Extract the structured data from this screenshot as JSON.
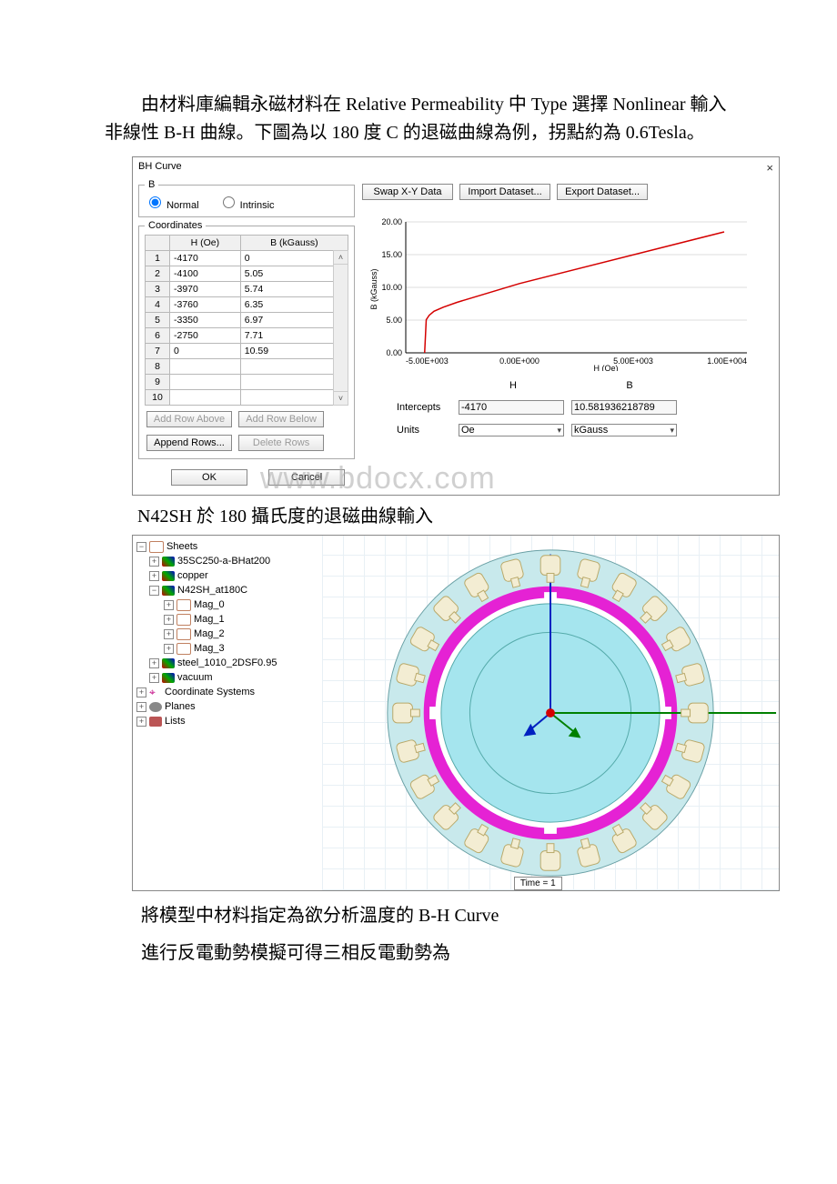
{
  "paragraphs": {
    "p1": "由材料庫編輯永磁材料在 Relative Permeability 中 Type 選擇 Nonlinear 輸入非線性 B-H 曲線。下圖為以 180 度 C 的退磁曲線為例，拐點約為 0.6Tesla。",
    "caption1": "N42SH 於 180 攝氏度的退磁曲線輸入",
    "p2": "將模型中材料指定為欲分析溫度的 B-H Curve",
    "p3": "進行反電動勢模擬可得三相反電動勢為"
  },
  "watermark": "www.bdocx.com",
  "dialog": {
    "title": "BH Curve",
    "close": "×",
    "group_b": "B",
    "radio_normal": "Normal",
    "radio_intrinsic": "Intrinsic",
    "btn_swap": "Swap X-Y Data",
    "btn_import": "Import Dataset...",
    "btn_export": "Export Dataset...",
    "group_coord": "Coordinates",
    "col_h": "H (Oe)",
    "col_b": "B (kGauss)",
    "rows": [
      {
        "n": "1",
        "h": "-4170",
        "b": "0"
      },
      {
        "n": "2",
        "h": "-4100",
        "b": "5.05"
      },
      {
        "n": "3",
        "h": "-3970",
        "b": "5.74"
      },
      {
        "n": "4",
        "h": "-3760",
        "b": "6.35"
      },
      {
        "n": "5",
        "h": "-3350",
        "b": "6.97"
      },
      {
        "n": "6",
        "h": "-2750",
        "b": "7.71"
      },
      {
        "n": "7",
        "h": "0",
        "b": "10.59"
      },
      {
        "n": "8",
        "h": "",
        "b": ""
      },
      {
        "n": "9",
        "h": "",
        "b": ""
      },
      {
        "n": "10",
        "h": "",
        "b": ""
      }
    ],
    "btn_add_above": "Add Row Above",
    "btn_add_below": "Add Row Below",
    "btn_append": "Append Rows...",
    "btn_delete": "Delete Rows",
    "intercepts_hdr_h": "H",
    "intercepts_hdr_b": "B",
    "intercepts_lbl": "Intercepts",
    "intercept_h": "-4170",
    "intercept_b": "10.581936218789",
    "units_lbl": "Units",
    "unit_h": "Oe",
    "unit_b": "kGauss",
    "ok": "OK",
    "cancel": "Cancel",
    "ylabel": "B (kGauss)",
    "xlabel": "H (Oe)",
    "yticks": [
      "0.00",
      "5.00",
      "10.00",
      "15.00",
      "20.00"
    ],
    "xticks": [
      "-5.00E+003",
      "0.00E+000",
      "5.00E+003",
      "1.00E+004"
    ]
  },
  "chart_data": {
    "type": "line",
    "title": "",
    "xlabel": "H (Oe)",
    "ylabel": "B (kGauss)",
    "xlim": [
      -5000,
      10000
    ],
    "ylim": [
      0,
      20
    ],
    "series": [
      {
        "name": "BH curve",
        "color": "#d40000",
        "x": [
          -4170,
          -4100,
          -3970,
          -3760,
          -3350,
          -2750,
          0,
          9000
        ],
        "y": [
          0,
          5.05,
          5.74,
          6.35,
          6.97,
          7.71,
          10.59,
          18.5
        ]
      }
    ]
  },
  "tree": {
    "root": "Sheets",
    "items": [
      "35SC250-a-BHat200",
      "copper",
      "N42SH_at180C",
      "Mag_0",
      "Mag_1",
      "Mag_2",
      "Mag_3",
      "steel_1010_2DSF0.95",
      "vacuum"
    ],
    "coord_sys": "Coordinate Systems",
    "planes": "Planes",
    "lists": "Lists",
    "time": "Time = 1"
  }
}
